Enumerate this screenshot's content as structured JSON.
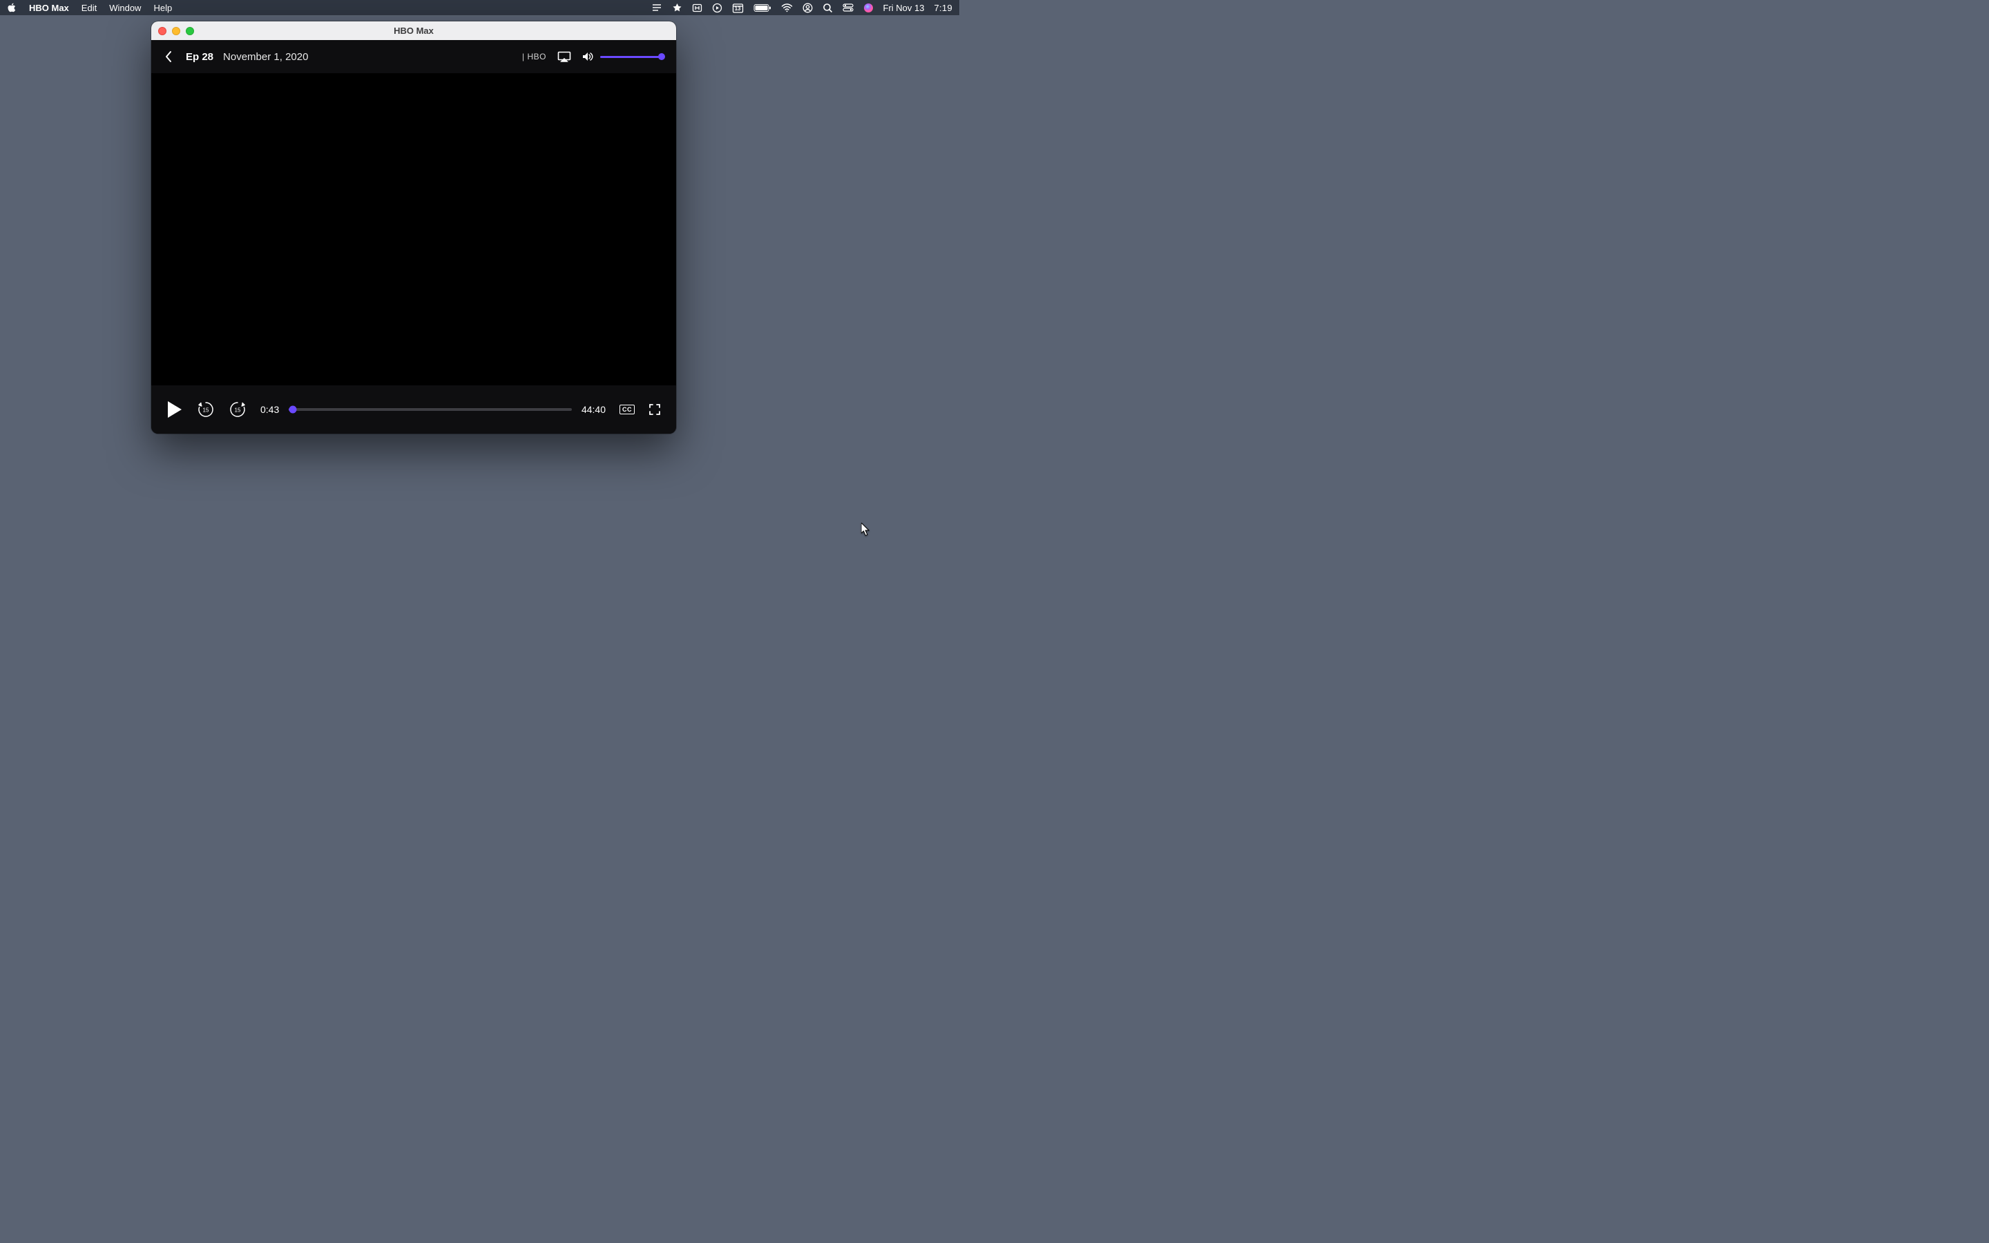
{
  "menubar": {
    "app_name": "HBO Max",
    "items": [
      "Edit",
      "Window",
      "Help"
    ],
    "status": {
      "calendar_day": "13",
      "date": "Fri Nov 13",
      "time": "7:19"
    }
  },
  "window": {
    "title": "HBO Max"
  },
  "player": {
    "episode_label": "Ep 28",
    "episode_date": "November 1, 2020",
    "network_tag": "| HBO",
    "volume_percent": 100,
    "current_time": "0:43",
    "total_time": "44:40",
    "progress_percent": 1.6,
    "skip_back_seconds": "15",
    "skip_fwd_seconds": "15",
    "cc_label": "CC"
  },
  "colors": {
    "accent": "#6a49ff",
    "window_bg": "#0e0e10",
    "desktop": "#5a6373"
  }
}
